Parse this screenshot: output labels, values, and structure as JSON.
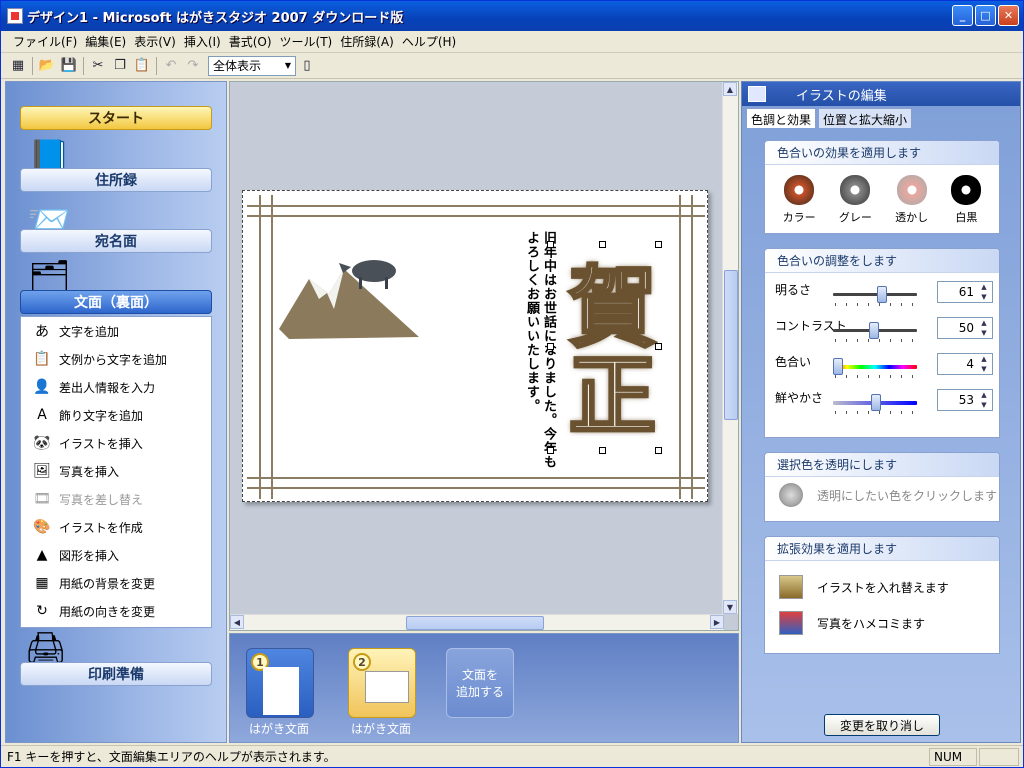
{
  "window": {
    "title": "デザイン1 - Microsoft はがきスタジオ 2007 ダウンロード版",
    "minimize": "_",
    "maximize": "□",
    "close": "✕"
  },
  "menu": [
    "ファイル(F)",
    "編集(E)",
    "表示(V)",
    "挿入(I)",
    "書式(O)",
    "ツール(T)",
    "住所録(A)",
    "ヘルプ(H)"
  ],
  "toolbar": {
    "zoom": "全体表示"
  },
  "nav": {
    "start": "スタート",
    "address": "住所録",
    "atena": "宛名面",
    "omote": "文面（裏面）",
    "print": "印刷準備"
  },
  "tasks": [
    {
      "label": "文字を追加",
      "icon": "あ",
      "enabled": true
    },
    {
      "label": "文例から文字を追加",
      "icon": "📋",
      "enabled": true
    },
    {
      "label": "差出人情報を入力",
      "icon": "👤",
      "enabled": true
    },
    {
      "label": "飾り文字を追加",
      "icon": "A",
      "enabled": true
    },
    {
      "label": "イラストを挿入",
      "icon": "🐼",
      "enabled": true
    },
    {
      "label": "写真を挿入",
      "icon": "🖼",
      "enabled": true
    },
    {
      "label": "写真を差し替え",
      "icon": "🎞",
      "enabled": false
    },
    {
      "label": "イラストを作成",
      "icon": "🎨",
      "enabled": true
    },
    {
      "label": "図形を挿入",
      "icon": "▲",
      "enabled": true
    },
    {
      "label": "用紙の背景を変更",
      "icon": "▦",
      "enabled": true
    },
    {
      "label": "用紙の向きを変更",
      "icon": "↻",
      "enabled": true
    }
  ],
  "card": {
    "message": "旧年中はお世話になりました。今年もよろしくお願いいたします。",
    "greeting": "賀正"
  },
  "thumbs": [
    {
      "num": "1",
      "label": "はがき文面"
    },
    {
      "num": "2",
      "label": "はがき文面"
    },
    {
      "add": "文面を\n追加する"
    }
  ],
  "right": {
    "title": "イラストの編集",
    "tabs": [
      "色調と効果",
      "位置と拡大縮小"
    ],
    "effect": {
      "header": "色合いの効果を適用します",
      "options": [
        "カラー",
        "グレー",
        "透かし",
        "白黒"
      ]
    },
    "adjust": {
      "header": "色合いの調整をします",
      "rows": [
        {
          "label": "明るさ",
          "value": "61"
        },
        {
          "label": "コントラスト",
          "value": "50"
        },
        {
          "label": "色合い",
          "value": "4"
        },
        {
          "label": "鮮やかさ",
          "value": "53"
        }
      ]
    },
    "transparent": {
      "header": "選択色を透明にします",
      "hint": "透明にしたい色をクリックします"
    },
    "extend": {
      "header": "拡張効果を適用します",
      "items": [
        "イラストを入れ替えます",
        "写真をハメコミます"
      ]
    },
    "undo": "変更を取り消し"
  },
  "status": {
    "text": "F1 キーを押すと、文面編集エリアのヘルプが表示されます。",
    "num": "NUM"
  }
}
